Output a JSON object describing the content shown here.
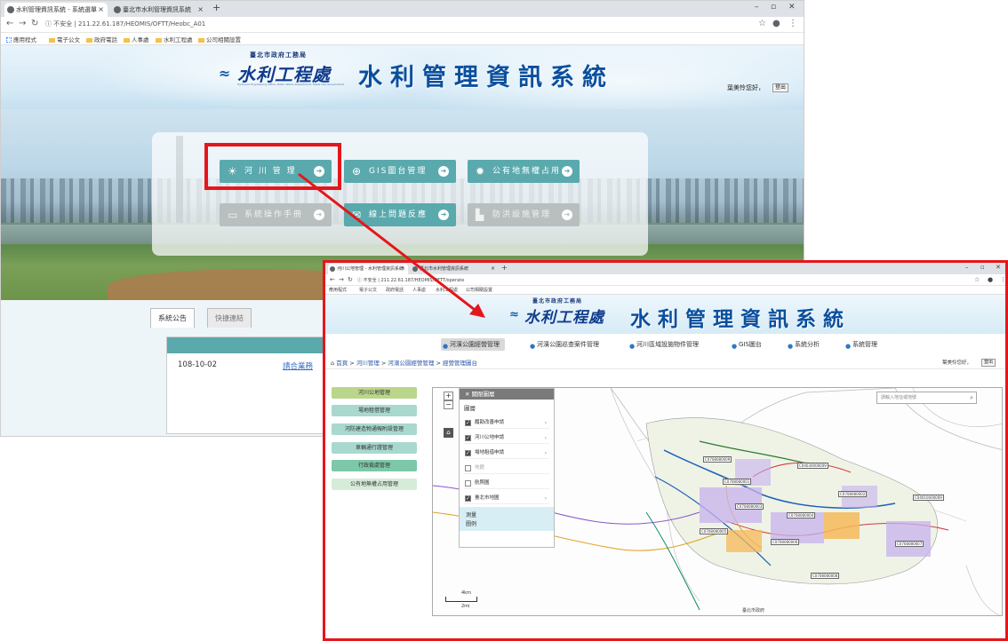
{
  "back_window": {
    "tabs": [
      {
        "label": "水利管理資訊系統 - 系統選單"
      },
      {
        "label": "臺北市水利管理資訊系統"
      }
    ],
    "url": "211.22.61.187/HEOMIS/OFTT/Heobc_A01",
    "url_security": "不安全",
    "bookmarks": [
      "應用程式",
      "電子公文",
      "政府電話",
      "人事處",
      "水利工程處",
      "公司相關設置"
    ],
    "header": {
      "logo_top": "臺北市政府工務局",
      "logo_main": "水利工程處",
      "logo_sub": "Hydraulic Engineering Office, Public Works Department, Taipei City Government",
      "system_title": "水利管理資訊系統",
      "greeting": "葉美怜您好，",
      "logout": "登出"
    },
    "menu": [
      {
        "label": "河 川 管 理",
        "icon": "lightbulb-icon",
        "enabled": true
      },
      {
        "label": "GIS圖台管理",
        "icon": "globe-icon",
        "enabled": true
      },
      {
        "label": "公有地無權占用",
        "icon": "gear-icon",
        "enabled": true
      },
      {
        "label": "系統操作手冊",
        "icon": "book-icon",
        "enabled": false
      },
      {
        "label": "線上問題反應",
        "icon": "message-icon",
        "enabled": true
      },
      {
        "label": "防洪設施管理",
        "icon": "chart-icon",
        "enabled": false
      }
    ],
    "announcement_tabs": [
      "系統公告",
      "快捷連結"
    ],
    "announcement": {
      "date": "108-10-02",
      "title": "請合業務"
    }
  },
  "front_window": {
    "tabs": [
      {
        "label": "河川公地管理 - 水利管理資訊系統"
      },
      {
        "label": "臺北市水利管理資訊系統"
      }
    ],
    "url": "211.22.61.187/HEOMIS/OFTT/operate",
    "url_security": "不安全",
    "bookmarks": [
      "應用程式",
      "電子公文",
      "政府電話",
      "人事處",
      "水利工程處",
      "公司相關設置"
    ],
    "header": {
      "logo_top": "臺北市政府工務局",
      "logo_main": "水利工程處",
      "system_title": "水利管理資訊系統",
      "greeting": "葉美怜您好，",
      "logout": "登出"
    },
    "top_nav": [
      "河濱公園經營管理",
      "河濱公園巡查案件管理",
      "河川區域設施物件管理",
      "GIS圖台",
      "系統分析",
      "系統管理"
    ],
    "breadcrumb": {
      "home": "首頁",
      "parts": [
        "河川管理",
        "河濱公園經營管理",
        "經營管理圖台"
      ]
    },
    "side_menu": [
      "河川公地管理",
      "場地租借管理",
      "河防建造物通報附設管理",
      "車輛通行證管理",
      "行政裁處管理",
      "公有地無權占用管理"
    ],
    "layer_panel": {
      "header": "關閉圖層",
      "title": "圖層",
      "items": [
        {
          "label": "履勘改善申請",
          "checked": true,
          "enabled": true
        },
        {
          "label": "河川公地申請",
          "checked": true,
          "enabled": true
        },
        {
          "label": "場地租借申請",
          "checked": true,
          "enabled": true
        },
        {
          "label": "地籍",
          "checked": false,
          "enabled": false
        },
        {
          "label": "航照圖",
          "checked": false,
          "enabled": true
        },
        {
          "label": "臺北市地圖",
          "checked": true,
          "enabled": true
        }
      ],
      "bottom": [
        "測量",
        "圖例"
      ]
    },
    "search_placeholder": "請輸入地址或地號",
    "scale": {
      "top": "4km",
      "bottom": "2mi"
    },
    "map_credit": "臺北市政府",
    "map_labels": [
      "C0708080009",
      "C04030000009",
      "C0708080001",
      "C0708080002",
      "C04010000009",
      "C0708080003",
      "C0708080004",
      "C0708080005",
      "C0708080006",
      "C0708080007",
      "C0708080008"
    ]
  },
  "colors": {
    "teal": "#5aa9ad",
    "highlight_red": "#e5161b",
    "title_blue": "#0a4f9e"
  }
}
